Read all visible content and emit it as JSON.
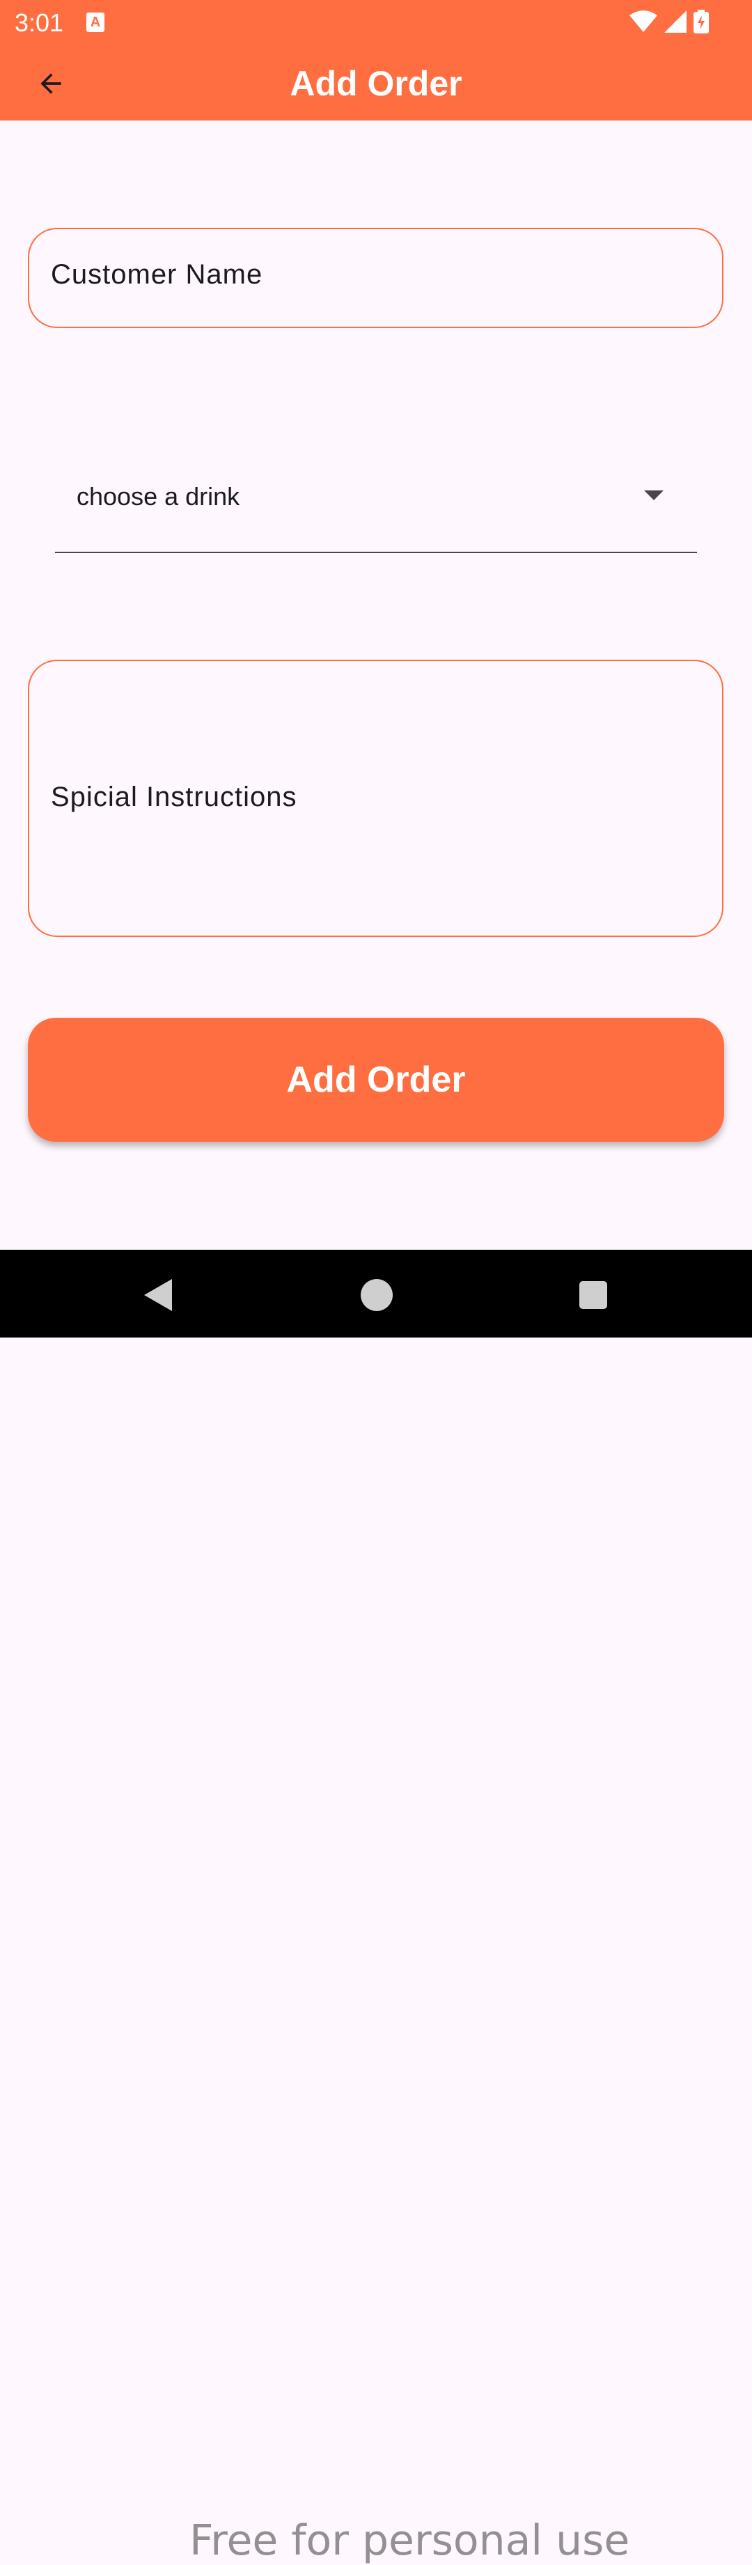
{
  "status_bar": {
    "time": "3:01",
    "notification_icon": "text-notification-icon",
    "icons": [
      "wifi-icon",
      "signal-icon",
      "battery-charging-icon"
    ]
  },
  "app_bar": {
    "title": "Add Order",
    "back_icon": "arrow-back-icon"
  },
  "form": {
    "customer_name_label": "Customer Name",
    "drink_dropdown_value": "choose a drink",
    "dropdown_icon": "arrow-drop-down-icon",
    "special_instructions_label": "Spicial Instructions",
    "submit_label": "Add Order"
  },
  "nav_bar": {
    "icons": [
      "nav-back-icon",
      "nav-home-icon",
      "nav-recents-icon"
    ]
  },
  "watermark": "Free for personal use",
  "colors": {
    "accent": "#FF6E40",
    "background": "#FEF7FD",
    "nav_bar": "#000000"
  }
}
